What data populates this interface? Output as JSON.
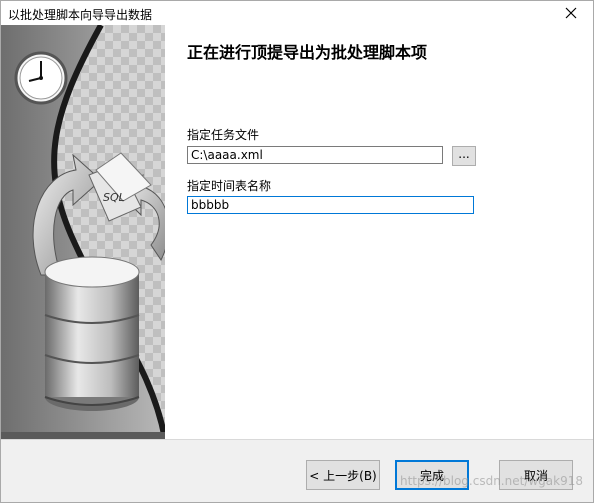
{
  "window": {
    "title": "以批处理脚本向导导出数据",
    "close_icon": "close-icon"
  },
  "art": {
    "clock_icon": "clock-icon",
    "folder_icon": "sql-folder-icon",
    "folder_label": "SQL",
    "database_icon": "database-icon"
  },
  "main": {
    "heading": "正在进行顶提导出为批处理脚本项",
    "task_file_label": "指定任务文件",
    "task_file_value": "C:\\aaaa.xml",
    "browse_label": "...",
    "schedule_name_label": "指定时间表名称",
    "schedule_name_value": "bbbbb"
  },
  "buttons": {
    "back": "< 上一步(B)",
    "finish": "完成",
    "cancel": "取消"
  },
  "watermark": "https://blog.csdn.net/wgak918"
}
